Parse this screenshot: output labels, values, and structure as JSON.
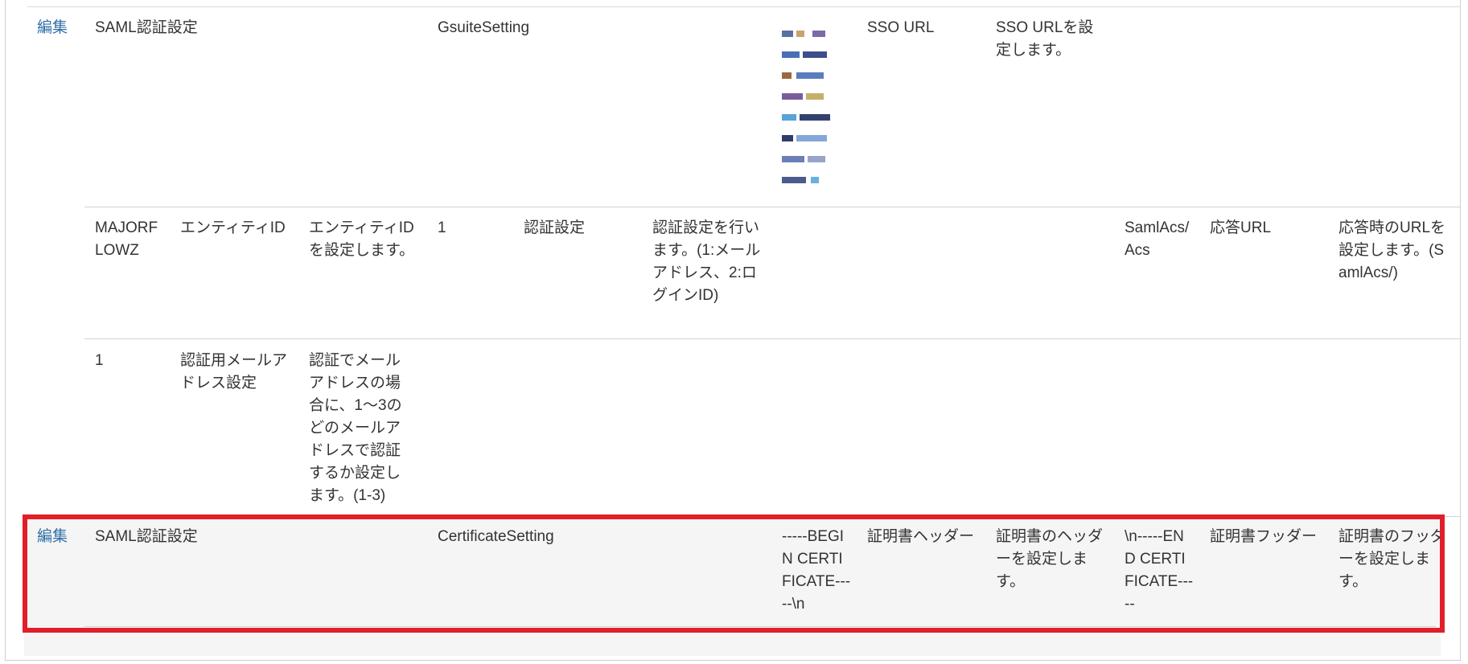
{
  "table": {
    "rows": [
      {
        "edit": "編集",
        "category": "SAML認証設定",
        "setting_name": "GsuiteSetting",
        "value": "",
        "label": "SSO URL",
        "description": "SSO URLを設定します。"
      },
      {
        "col1": "MAJORFLOWZ",
        "col2": "エンティティID",
        "col3": "エンティティIDを設定します。",
        "col4": "1",
        "col5": "認証設定",
        "col6": "認証設定を行います。(1:メールアドレス、2:ログインID)",
        "col7": "SamlAcs/Acs",
        "col8": "応答URL",
        "col9": "応答時のURLを設定します。(SamlAcs/)"
      },
      {
        "col1": "1",
        "col2": "認証用メールアドレス設定",
        "col3": "認証でメールアドレスの場合に、1〜3のどのメールアドレスで認証するか設定します。(1-3)"
      },
      {
        "edit": "編集",
        "category": "SAML認証設定",
        "setting_name": "CertificateSetting",
        "header_value": "-----BEGIN CERTIFICATE-----\\n",
        "header_label": "証明書ヘッダー",
        "header_desc": "証明書のヘッダーを設定します。",
        "footer_value": "\\n-----END CERTIFICATE-----",
        "footer_label": "証明書フッダー",
        "footer_desc": "証明書のフッダーを設定します。"
      }
    ]
  },
  "colors": {
    "highlight": "#e01f29",
    "link": "#2f6fa8",
    "selected_row": "#f5f5f5"
  }
}
